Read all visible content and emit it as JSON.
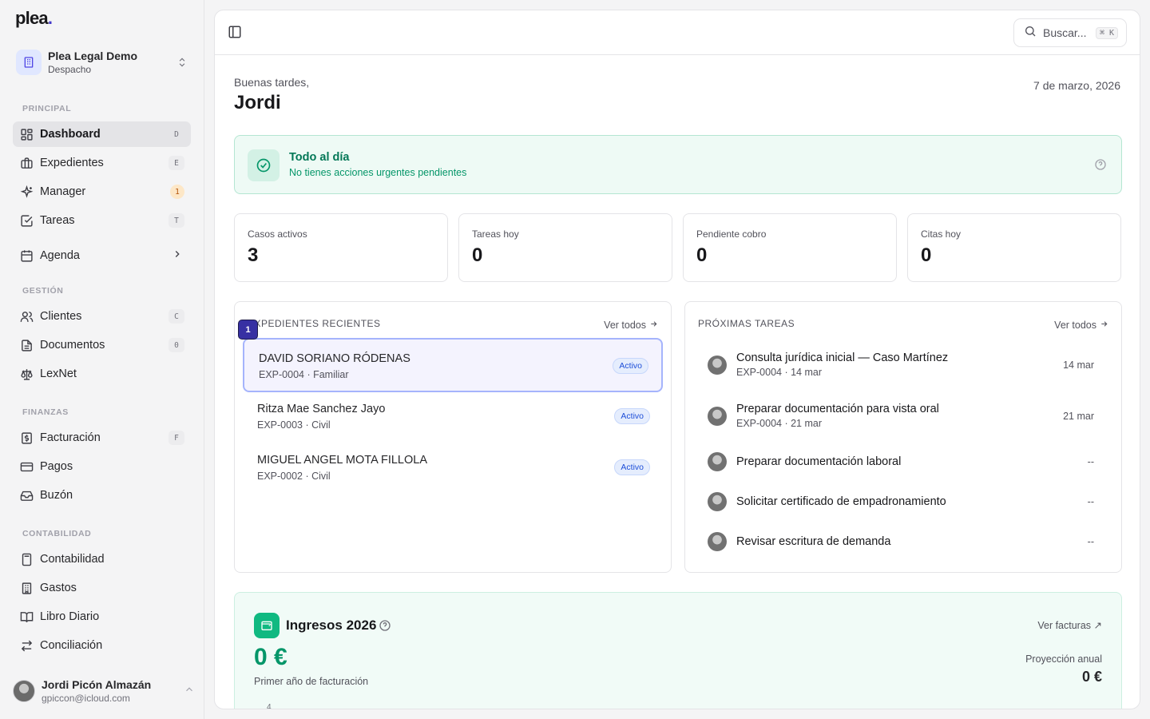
{
  "brand": {
    "logo_text": "plea",
    "logo_dot": "."
  },
  "workspace": {
    "name": "Plea Legal Demo",
    "subtitle": "Despacho"
  },
  "sidebar": {
    "sections": [
      {
        "label": "PRINCIPAL"
      },
      {
        "label": "GESTIÓN"
      },
      {
        "label": "FINANZAS"
      },
      {
        "label": "CONTABILIDAD"
      }
    ],
    "items": [
      {
        "label": "Dashboard",
        "shortcut": "D",
        "icon": "dashboard-icon",
        "active": true
      },
      {
        "label": "Expedientes",
        "shortcut": "E",
        "icon": "briefcase-icon"
      },
      {
        "label": "Manager",
        "badge": "1",
        "icon": "sparkles-icon"
      },
      {
        "label": "Tareas",
        "shortcut": "T",
        "icon": "check-square-icon"
      },
      {
        "label": "Agenda",
        "icon": "calendar-icon"
      },
      {
        "label": "Clientes",
        "shortcut": "C",
        "icon": "users-icon"
      },
      {
        "label": "Documentos",
        "shortcut": "0",
        "icon": "file-text-icon"
      },
      {
        "label": "LexNet",
        "icon": "scale-icon"
      },
      {
        "label": "Facturación",
        "shortcut": "F",
        "icon": "dollar-receipt-icon"
      },
      {
        "label": "Pagos",
        "icon": "credit-card-icon"
      },
      {
        "label": "Buzón",
        "icon": "inbox-icon"
      },
      {
        "label": "Contabilidad",
        "icon": "calculator-icon"
      },
      {
        "label": "Gastos",
        "icon": "building-icon"
      },
      {
        "label": "Libro Diario",
        "icon": "book-icon"
      },
      {
        "label": "Conciliación",
        "icon": "arrows-exchange-icon"
      }
    ]
  },
  "user": {
    "name": "Jordi Picón Almazán",
    "email": "gpiccon@icloud.com"
  },
  "topbar": {
    "search_placeholder": "Buscar...",
    "search_shortcut": "⌘ K"
  },
  "header": {
    "greeting": "Buenas tardes,",
    "name": "Jordi",
    "date": "7 de marzo, 2026"
  },
  "alert": {
    "title": "Todo al día",
    "subtitle": "No tienes acciones urgentes pendientes"
  },
  "stats": [
    {
      "label": "Casos activos",
      "value": "3"
    },
    {
      "label": "Tareas hoy",
      "value": "0"
    },
    {
      "label": "Pendiente cobro",
      "value": "0"
    },
    {
      "label": "Citas hoy",
      "value": "0"
    }
  ],
  "recent_cases": {
    "title": "Expedientes recientes",
    "link": "Ver todos",
    "marker": "1",
    "items": [
      {
        "name": "DAVID SORIANO RÓDENAS",
        "sub": "EXP-0004 · Familiar",
        "status": "Activo"
      },
      {
        "name": "Ritza Mae Sanchez Jayo",
        "sub": "EXP-0003 · Civil",
        "status": "Activo"
      },
      {
        "name": "MIGUEL ANGEL MOTA FILLOLA",
        "sub": "EXP-0002 · Civil",
        "status": "Activo"
      }
    ]
  },
  "upcoming_tasks": {
    "title": "Próximas tareas",
    "link": "Ver todos",
    "items": [
      {
        "title": "Consulta jurídica inicial — Caso Martínez",
        "sub": "EXP-0004 · 14 mar",
        "date": "14 mar"
      },
      {
        "title": "Preparar documentación para vista oral",
        "sub": "EXP-0004 · 21 mar",
        "date": "21 mar"
      },
      {
        "title": "Preparar documentación laboral",
        "sub": "",
        "date": "--"
      },
      {
        "title": "Solicitar certificado de empadronamiento",
        "sub": "",
        "date": "--"
      },
      {
        "title": "Revisar escritura de demanda",
        "sub": "",
        "date": "--"
      }
    ]
  },
  "income": {
    "title": "Ingresos 2026",
    "link": "Ver facturas ↗",
    "value": "0 €",
    "subtitle": "Primer año de facturación",
    "projection_label": "Proyección anual",
    "projection_value": "0 €",
    "axis_tick": "4"
  },
  "colors": {
    "accent": "#4338ca",
    "success": "#059669",
    "badge_blue": "#1d4ed8"
  }
}
